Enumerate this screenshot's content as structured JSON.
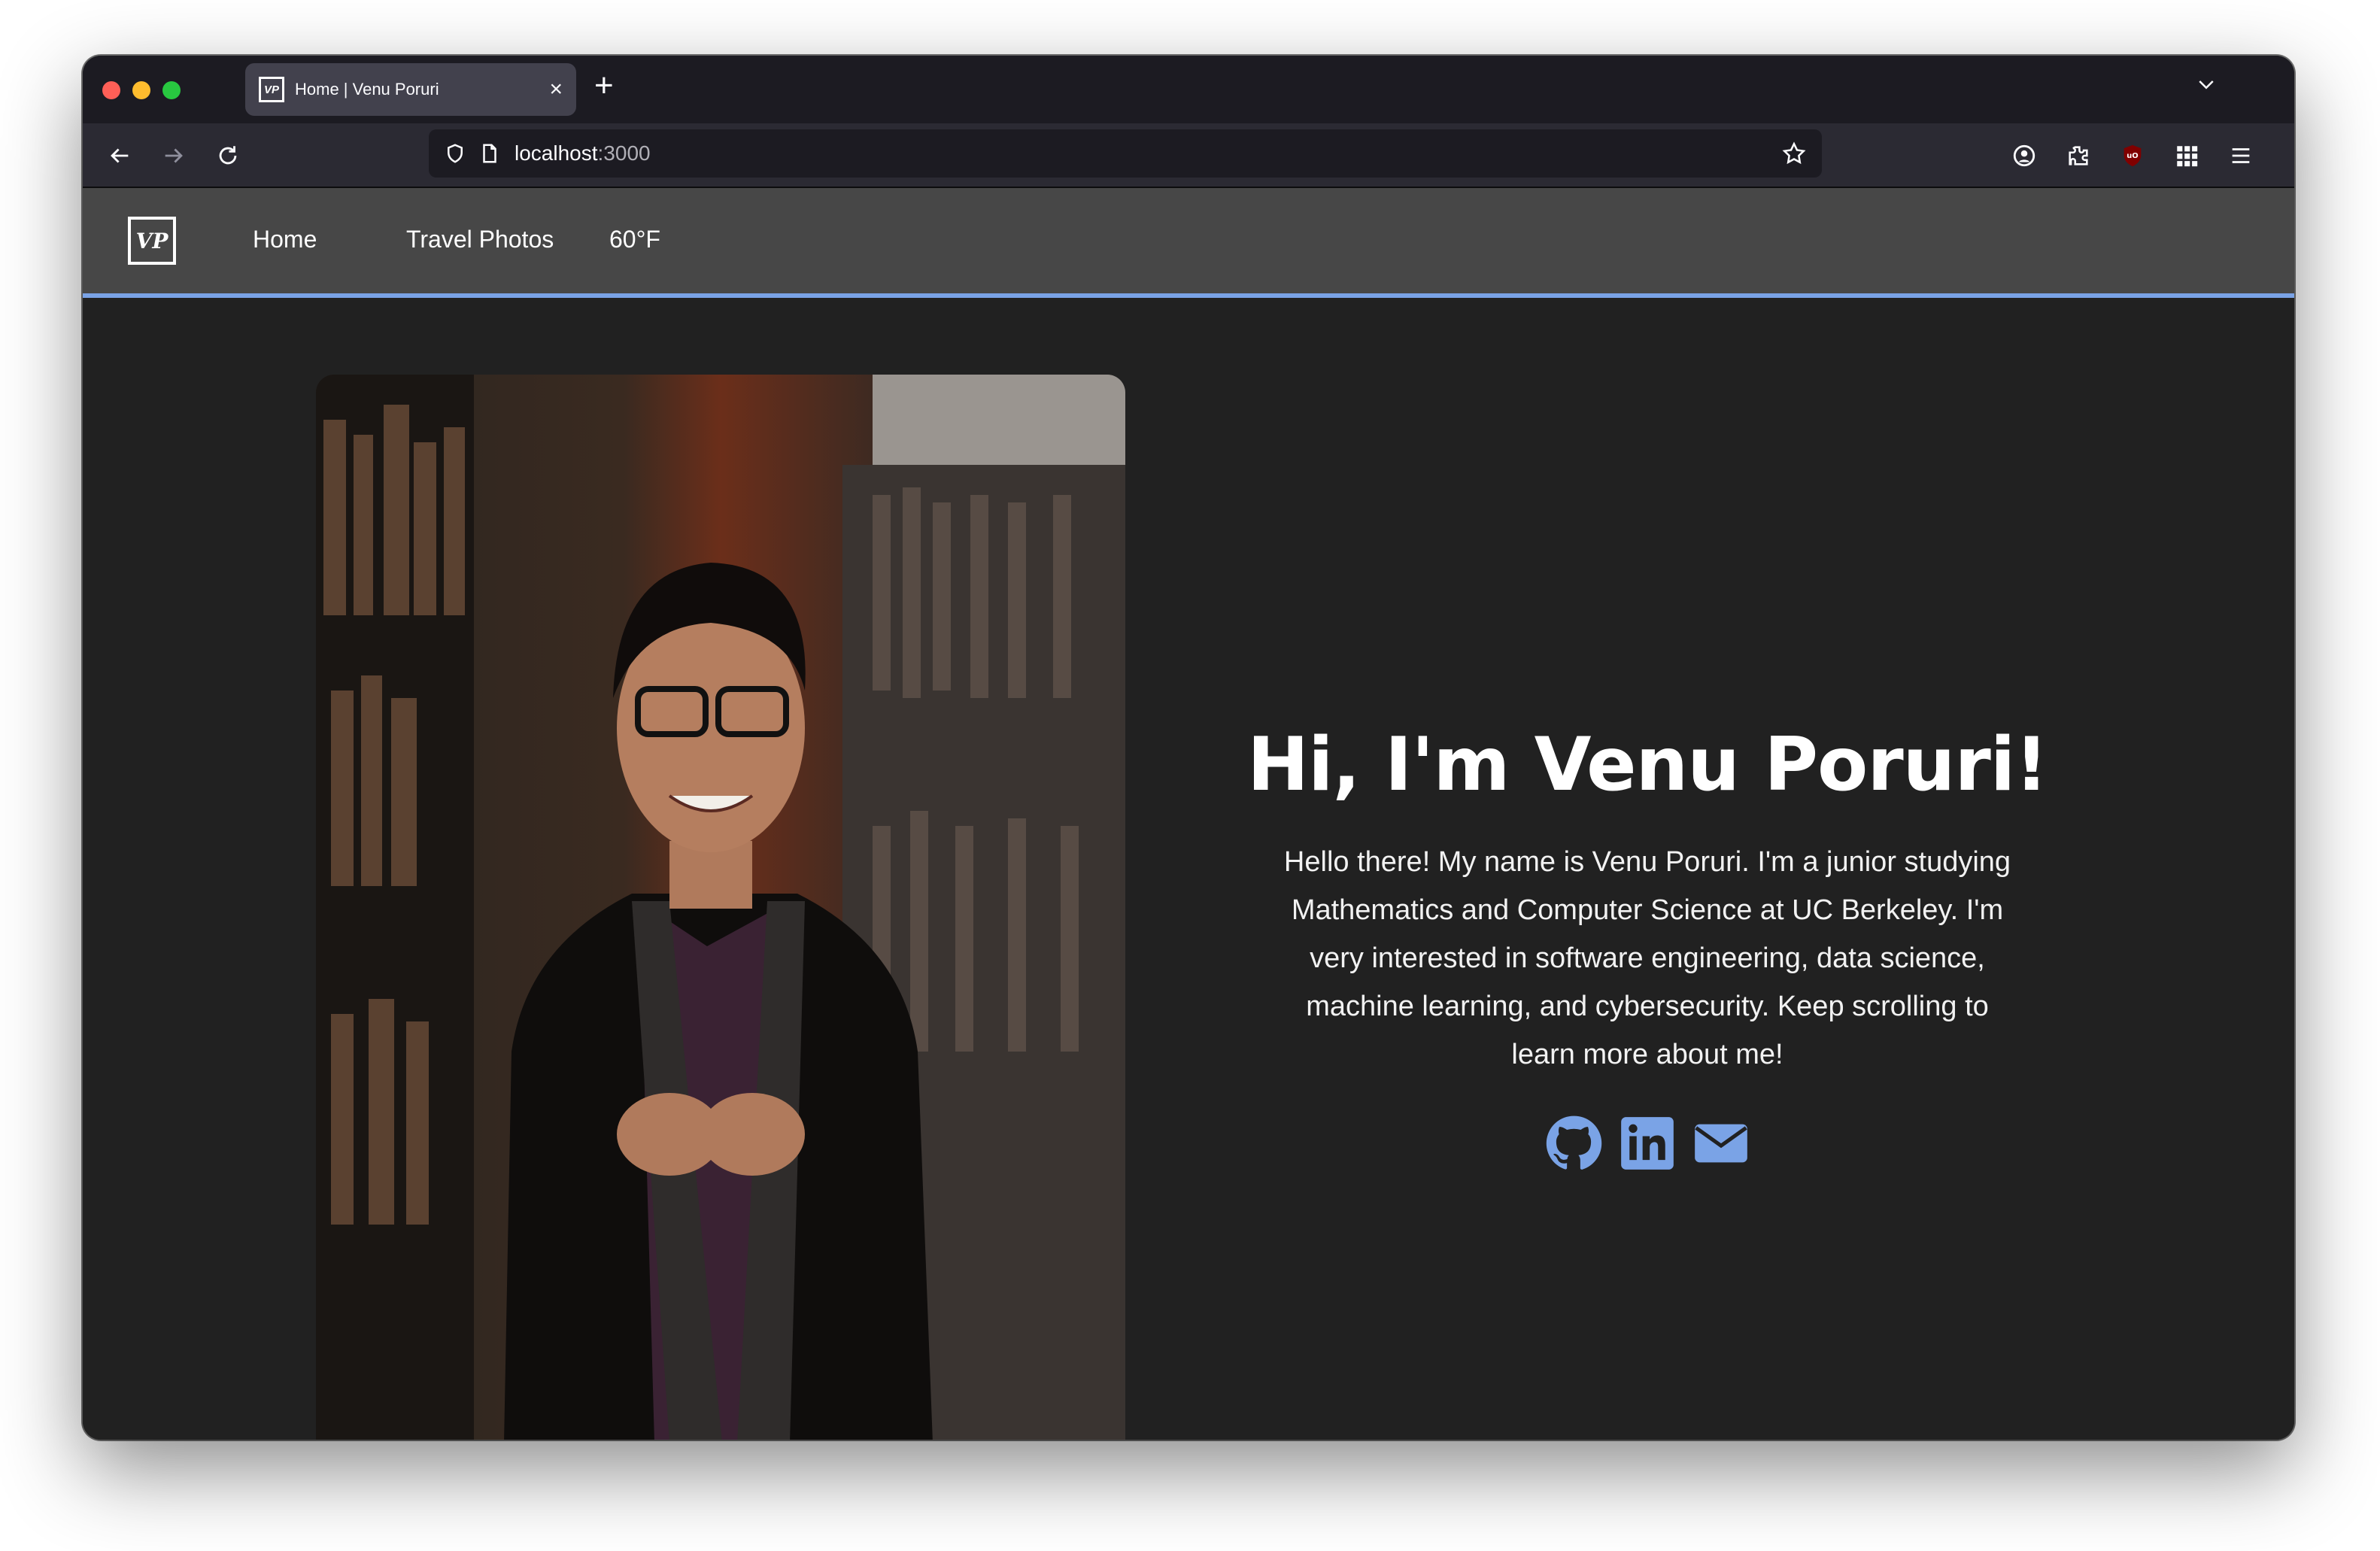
{
  "browser": {
    "tab_title": "Home | Venu Poruri",
    "favicon_text": "VP",
    "url_host": "localhost",
    "url_port": ":3000",
    "icons": [
      "back-icon",
      "forward-icon",
      "reload-icon",
      "shield-icon",
      "page-icon",
      "bookmark-star-icon",
      "account-icon",
      "extensions-icon",
      "ublock-icon",
      "apps-grid-icon",
      "menu-icon"
    ]
  },
  "site": {
    "logo_text": "VP",
    "nav": {
      "home": "Home",
      "travel": "Travel Photos",
      "weather": "60°F"
    },
    "hero": {
      "title": "Hi, I'm Venu Poruri!",
      "intro": "Hello there! My name is Venu Poruri. I'm a junior studying Mathematics and Computer Science at UC Berkeley. I'm very interested in software engineering, data science, machine learning, and cybersecurity. Keep scrolling to learn more about me!",
      "socials": [
        "github-icon",
        "linkedin-icon",
        "email-icon"
      ]
    }
  },
  "colors": {
    "accent": "#7aa3e6",
    "page_bg": "#212121",
    "nav_bg": "#474747"
  }
}
